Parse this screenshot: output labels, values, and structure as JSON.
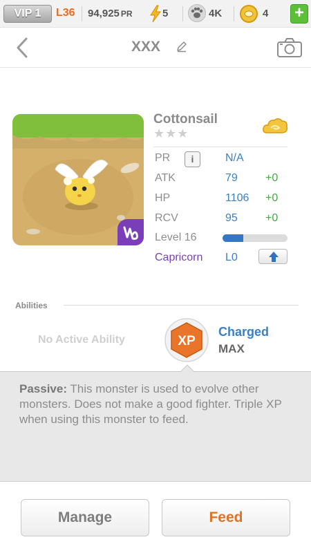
{
  "topbar": {
    "vip": "VIP 1",
    "level": "L36",
    "pr": "94,925",
    "pr_unit": "PR",
    "energy": "5",
    "paws": "4K",
    "coins": "4",
    "add": "+"
  },
  "header": {
    "title": "XXX"
  },
  "monster": {
    "name": "Cottonsail",
    "stars": "★★★",
    "stats": [
      {
        "label": "PR",
        "value": "N/A",
        "bonus": ""
      },
      {
        "label": "ATK",
        "value": "79",
        "bonus": "+0"
      },
      {
        "label": "HP",
        "value": "1106",
        "bonus": "+0"
      },
      {
        "label": "RCV",
        "value": "95",
        "bonus": "+0"
      }
    ],
    "info_label": "i",
    "level": "Level 16",
    "level_progress": 0.32,
    "zodiac": "Capricorn",
    "zodiac_level": "L0"
  },
  "abilities": {
    "heading": "Abilities",
    "active": "No Active Ability",
    "badge": "XP",
    "charge_title": "Charged",
    "charge_value": "MAX"
  },
  "passive": {
    "prefix": "Passive:",
    "text": "This monster is used to evolve other monsters. Does not make a good fighter. Triple XP when using this monster to feed."
  },
  "buttons": {
    "manage": "Manage",
    "feed": "Feed"
  },
  "colors": {
    "accent": "#3b7fc4",
    "orange": "#e07227",
    "green": "#46a842",
    "purple": "#7a3fb8"
  }
}
